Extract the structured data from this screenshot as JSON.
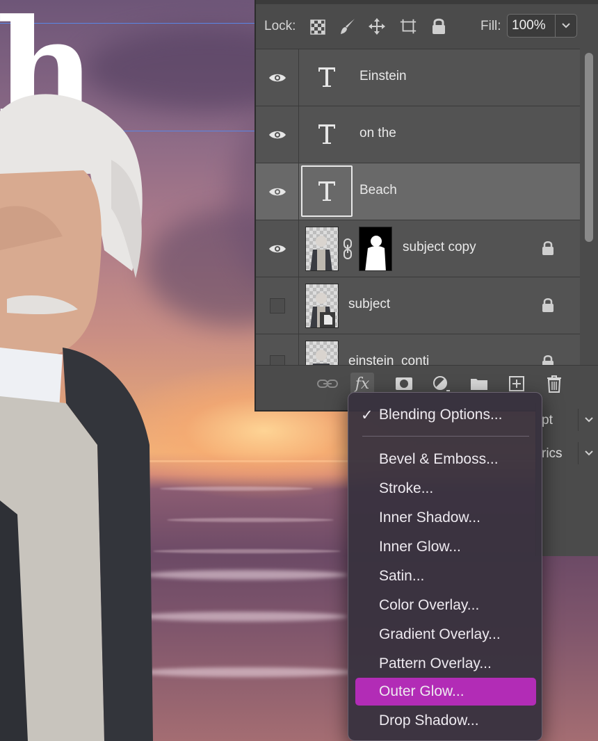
{
  "canvas": {
    "visible_letter": "h"
  },
  "layers_panel": {
    "lock_label": "Lock:",
    "fill_label": "Fill:",
    "fill_value": "100%",
    "layers": [
      {
        "name": "Einstein",
        "kind": "type",
        "visible": true,
        "selected": false
      },
      {
        "name": "on the",
        "kind": "type",
        "visible": true,
        "selected": false
      },
      {
        "name": "Beach",
        "kind": "type",
        "visible": true,
        "selected": true
      },
      {
        "name": "subject copy",
        "kind": "image-with-mask",
        "visible": true,
        "locked": true
      },
      {
        "name": "subject",
        "kind": "smart-object",
        "visible": false,
        "locked": true
      },
      {
        "name": "einstein_conti",
        "kind": "image",
        "visible": false,
        "locked": true
      }
    ],
    "type_glyph": "T",
    "fx_label": "fx"
  },
  "properties_panel": {
    "size_unit": "pt",
    "kerning_fragment": "rics"
  },
  "fx_menu": {
    "items": [
      {
        "label": "Blending Options...",
        "checked": true
      },
      {
        "label": "Bevel & Emboss..."
      },
      {
        "label": "Stroke..."
      },
      {
        "label": "Inner Shadow..."
      },
      {
        "label": "Inner Glow..."
      },
      {
        "label": "Satin..."
      },
      {
        "label": "Color Overlay..."
      },
      {
        "label": "Gradient Overlay..."
      },
      {
        "label": "Pattern Overlay..."
      },
      {
        "label": "Outer Glow...",
        "highlighted": true
      },
      {
        "label": "Drop Shadow..."
      }
    ],
    "check_glyph": "✓",
    "highlight_color": "#b22cb6"
  }
}
